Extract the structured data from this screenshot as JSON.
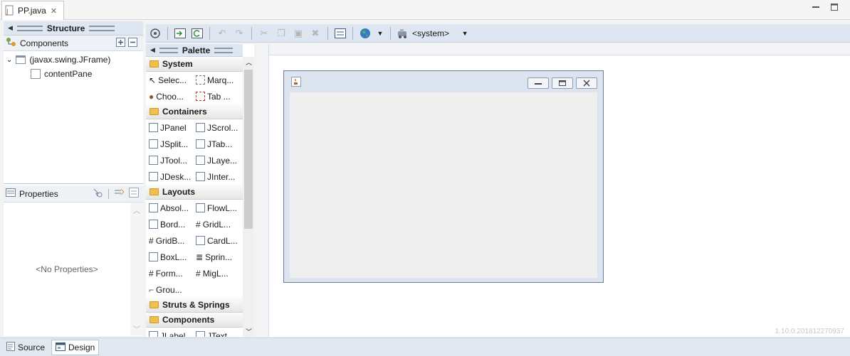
{
  "editor": {
    "tab_label": "PP.java"
  },
  "structure": {
    "title": "Structure",
    "components_label": "Components"
  },
  "tree": {
    "items": [
      {
        "label": "(javax.swing.JFrame)"
      },
      {
        "label": "contentPane"
      }
    ]
  },
  "properties": {
    "title": "Properties",
    "empty_text": "<No Properties>"
  },
  "palette": {
    "title": "Palette",
    "categories": {
      "system": "System",
      "containers": "Containers",
      "layouts": "Layouts",
      "struts": "Struts & Springs",
      "components": "Components"
    },
    "system_items": [
      "Selec...",
      "Marq...",
      "Choo...",
      "Tab ..."
    ],
    "container_items": [
      "JPanel",
      "JScrol...",
      "JSplit...",
      "JTab...",
      "JTool...",
      "JLaye...",
      "JDesk...",
      "JInter..."
    ],
    "layout_items": [
      "Absol...",
      "FlowL...",
      "Bord...",
      "GridL...",
      "GridB...",
      "CardL...",
      "BoxL...",
      "Sprin...",
      "Form...",
      "MigL...",
      "Grou..."
    ],
    "component_items": [
      "JLabel",
      "JText..."
    ]
  },
  "toolbar": {
    "lookandfeel": "<system>"
  },
  "canvas": {
    "version_text": "1.10.0.201812270937"
  },
  "bottom_tabs": {
    "source": "Source",
    "design": "Design"
  },
  "colors": {
    "header_bg": "#dde6f1",
    "panel_bg": "#ffffff",
    "content_pane": "#efefef",
    "frame_border": "#dbe4ef"
  },
  "icons": [
    "java-file-icon",
    "close-icon",
    "minimize-icon",
    "maximize-icon",
    "collapse-arrow-icon",
    "components-tree-icon",
    "add-icon",
    "remove-icon",
    "frame-icon",
    "panel-icon",
    "properties-icon",
    "events-icon",
    "folder-icon",
    "globe-icon",
    "dropdown-icon",
    "source-icon",
    "design-icon"
  ]
}
